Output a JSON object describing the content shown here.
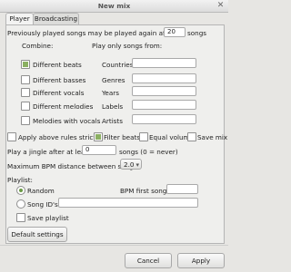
{
  "window": {
    "title": "New mix"
  },
  "tabs": [
    {
      "label": "Player"
    },
    {
      "label": "Broadcasting"
    }
  ],
  "repeat": {
    "prefix": "Previously played songs may be played again after",
    "value": "20",
    "suffix": "songs"
  },
  "combine": {
    "heading": "Combine:",
    "items": [
      {
        "label": "Different beats",
        "checked": true
      },
      {
        "label": "Different basses",
        "checked": false
      },
      {
        "label": "Different vocals",
        "checked": false
      },
      {
        "label": "Different melodies",
        "checked": false
      },
      {
        "label": "Melodies with vocals",
        "checked": false
      }
    ]
  },
  "only_from": {
    "heading": "Play only songs from:",
    "fields": [
      {
        "label": "Countries",
        "value": ""
      },
      {
        "label": "Genres",
        "value": ""
      },
      {
        "label": "Years",
        "value": ""
      },
      {
        "label": "Labels",
        "value": ""
      },
      {
        "label": "Artists",
        "value": ""
      }
    ]
  },
  "options": {
    "apply_strictly": {
      "label": "Apply above rules strictly",
      "checked": false
    },
    "filter_beats": {
      "label": "Filter beats",
      "checked": true
    },
    "equal_volume": {
      "label": "Equal volume",
      "checked": false
    },
    "save_mix": {
      "label": "Save mix",
      "checked": false
    }
  },
  "jingle": {
    "prefix": "Play a jingle after at least",
    "value": "0",
    "suffix": "songs (0 = never)"
  },
  "bpm": {
    "label": "Maximum BPM distance between songs",
    "selected": "2.0"
  },
  "playlist": {
    "heading": "Playlist:",
    "random_label": "Random",
    "bpm_first_label": "BPM first song",
    "bpm_first_value": "",
    "song_ids_label": "Song ID's",
    "song_ids_value": "",
    "save_label": "Save playlist",
    "mode": "random"
  },
  "buttons": {
    "default_settings": "Default settings",
    "cancel": "Cancel",
    "apply": "Apply"
  },
  "colors": {
    "check_fill": "#8bb062",
    "background": "#e7e6e3"
  },
  "icons": {
    "close": "close-icon",
    "select_arrow": "chevron-down-icon"
  }
}
